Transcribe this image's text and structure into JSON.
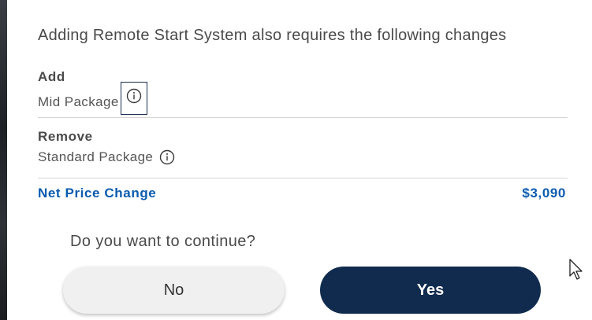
{
  "dialog": {
    "heading": "Adding Remote Start System also requires the following changes",
    "add": {
      "title": "Add",
      "item": "Mid Package"
    },
    "remove": {
      "title": "Remove",
      "item": "Standard Package"
    },
    "net_price": {
      "label": "Net Price Change",
      "value": "$3,090"
    },
    "question": "Do you want to continue?",
    "buttons": {
      "no": "No",
      "yes": "Yes"
    }
  },
  "colors": {
    "accent": "#0a5bb0",
    "primary_button": "#102b4e",
    "secondary_button": "#f0f0f0"
  },
  "icons": {
    "add_item_info": "info-icon",
    "remove_item_info": "info-icon",
    "pointer": "mouse-cursor-icon"
  }
}
